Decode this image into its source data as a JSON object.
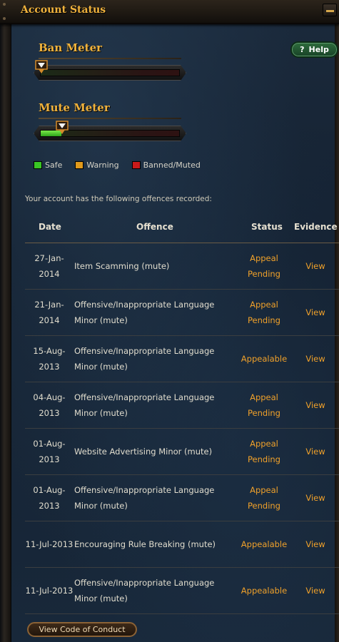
{
  "window": {
    "title": "Account Status"
  },
  "help": {
    "label": "Help",
    "icon": "question-mark-icon"
  },
  "ban_meter": {
    "title": "Ban Meter",
    "level_percent": 0
  },
  "mute_meter": {
    "title": "Mute Meter",
    "level_percent": 15
  },
  "legend": [
    {
      "label": "Safe",
      "color": "#39c524"
    },
    {
      "label": "Warning",
      "color": "#e09a1c"
    },
    {
      "label": "Banned/Muted",
      "color": "#c91a1a"
    }
  ],
  "intro": "Your account has the following offences recorded:",
  "table": {
    "headers": {
      "date": "Date",
      "offence": "Offence",
      "status": "Status",
      "evidence": "Evidence"
    },
    "rows": [
      {
        "date": "27-Jan-2014",
        "offence": "Item Scamming (mute)",
        "status": "Appeal Pending",
        "evidence": "View"
      },
      {
        "date": "21-Jan-2014",
        "offence": "Offensive/Inappropriate Language Minor (mute)",
        "status": "Appeal Pending",
        "evidence": "View"
      },
      {
        "date": "15-Aug-2013",
        "offence": "Offensive/Inappropriate Language Minor (mute)",
        "status": "Appealable",
        "evidence": "View"
      },
      {
        "date": "04-Aug-2013",
        "offence": "Offensive/Inappropriate Language Minor (mute)",
        "status": "Appeal Pending",
        "evidence": "View"
      },
      {
        "date": "01-Aug-2013",
        "offence": "Website Advertising Minor (mute)",
        "status": "Appeal Pending",
        "evidence": "View"
      },
      {
        "date": "01-Aug-2013",
        "offence": "Offensive/Inappropriate Language Minor (mute)",
        "status": "Appeal Pending",
        "evidence": "View"
      },
      {
        "date": "11-Jul-2013",
        "offence": "Encouraging Rule Breaking (mute)",
        "status": "Appealable",
        "evidence": "View"
      },
      {
        "date": "11-Jul-2013",
        "offence": "Offensive/Inappropriate Language Minor (mute)",
        "status": "Appealable",
        "evidence": "View"
      }
    ]
  },
  "footer": {
    "conduct_label": "View Code of Conduct"
  }
}
